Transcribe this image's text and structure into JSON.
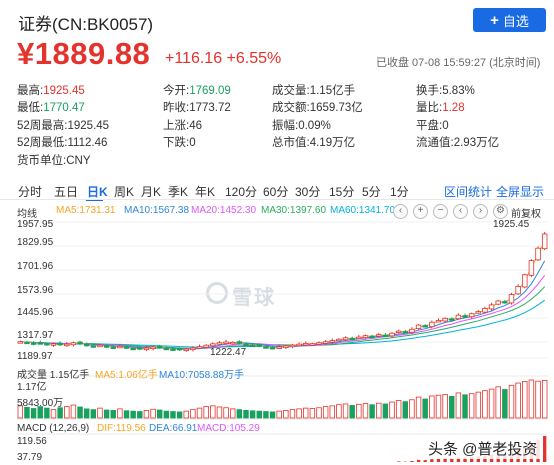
{
  "header": {
    "title": "证券(CN:BK0057)",
    "follow_label": "自选",
    "price": "¥1889.88",
    "change": "+116.16 +6.55%",
    "status": "已收盘 07-08 15:59:27 (北京时间)"
  },
  "stats": {
    "high_label": "最高:",
    "high": "1925.45",
    "low_label": "最低:",
    "low": "1770.47",
    "w52_high_label": "52周最高:",
    "w52_high": "1925.45",
    "w52_low_label": "52周最低:",
    "w52_low": "1112.46",
    "currency_label": "货币单位:",
    "currency": "CNY",
    "open_label": "今开:",
    "open": "1769.09",
    "prev_close_label": "昨收:",
    "prev_close": "1773.72",
    "up_label": "上涨:",
    "up": "46",
    "down_label": "下跌:",
    "down": "0",
    "volume_label": "成交量:",
    "volume": "1.15亿手",
    "amount_label": "成交额:",
    "amount": "1659.73亿",
    "amplitude_label": "振幅:",
    "amplitude": "0.09%",
    "mktcap_label": "总市值:",
    "mktcap": "4.19万亿",
    "turnover_label": "换手:",
    "turnover": "5.83%",
    "volratio_label": "量比:",
    "volratio": "1.28",
    "flat_label": "平盘:",
    "flat": "0",
    "float_label": "流通值:",
    "float": "2.93万亿"
  },
  "tabs": [
    "分时",
    "五日",
    "日K",
    "周K",
    "月K",
    "季K",
    "年K",
    "120分",
    "60分",
    "30分",
    "15分",
    "5分",
    "1分"
  ],
  "active_tab": "日K",
  "links": {
    "stats": "区间统计",
    "fullscreen": "全屏显示"
  },
  "legend": {
    "ma_type": "均线",
    "ma5": "MA5:1731.31",
    "ma10": "MA10:1567.38",
    "ma20": "MA20:1452.30",
    "ma30": "MA30:1397.60",
    "ma60": "MA60:1341.70",
    "fq": "前复权"
  },
  "colors": {
    "up": "#e4322c",
    "down": "#19a15f",
    "ma5": "#f5a623",
    "ma10": "#2e86de",
    "ma20": "#e056fd",
    "ma30": "#27ae60",
    "ma60": "#00b4d8"
  },
  "y_axis": [
    "1957.95",
    "1829.95",
    "1701.96",
    "1573.96",
    "1445.96",
    "1317.97",
    "1189.97"
  ],
  "price_labels": {
    "high": "1925.45",
    "low": "1222.47"
  },
  "volume": {
    "label": "成交量 1.15亿手",
    "ma5": "MA5:1.06亿手",
    "ma10": "MA10:7058.88万手",
    "axis_top": "1.17亿",
    "axis_mid": "5843.00万"
  },
  "macd": {
    "label": "MACD (12,26,9)",
    "dif": "DIF:119.56",
    "dea": "DEA:66.91",
    "macd": "MACD:105.29",
    "axis_top": "119.56",
    "axis_mid": "37.79"
  },
  "watermark": "雪球",
  "credit": "头条 @普老投资",
  "chart_data": {
    "type": "candlestick",
    "ylim": [
      1189.97,
      1957.95
    ],
    "closes": [
      1282,
      1278,
      1272,
      1275,
      1266,
      1270,
      1264,
      1268,
      1276,
      1270,
      1262,
      1258,
      1262,
      1255,
      1250,
      1256,
      1248,
      1244,
      1240,
      1246,
      1252,
      1248,
      1244,
      1240,
      1236,
      1240,
      1246,
      1254,
      1262,
      1270,
      1276,
      1280,
      1278,
      1272,
      1266,
      1262,
      1256,
      1252,
      1248,
      1252,
      1258,
      1262,
      1268,
      1272,
      1270,
      1276,
      1282,
      1288,
      1296,
      1304,
      1300,
      1308,
      1316,
      1312,
      1322,
      1318,
      1330,
      1342,
      1338,
      1352,
      1376,
      1370,
      1392,
      1402,
      1414,
      1408,
      1432,
      1426,
      1440,
      1452,
      1470,
      1490,
      1512,
      1504,
      1548,
      1594,
      1660,
      1740,
      1810,
      1890
    ],
    "volumes_rel": [
      0.32,
      0.28,
      0.25,
      0.3,
      0.26,
      0.22,
      0.27,
      0.3,
      0.34,
      0.29,
      0.24,
      0.22,
      0.26,
      0.21,
      0.2,
      0.24,
      0.19,
      0.18,
      0.17,
      0.2,
      0.23,
      0.21,
      0.18,
      0.17,
      0.16,
      0.18,
      0.22,
      0.26,
      0.3,
      0.32,
      0.29,
      0.27,
      0.24,
      0.22,
      0.2,
      0.19,
      0.18,
      0.17,
      0.16,
      0.18,
      0.2,
      0.22,
      0.24,
      0.26,
      0.25,
      0.27,
      0.3,
      0.32,
      0.35,
      0.37,
      0.33,
      0.36,
      0.38,
      0.35,
      0.39,
      0.37,
      0.42,
      0.46,
      0.43,
      0.48,
      0.55,
      0.5,
      0.58,
      0.6,
      0.62,
      0.57,
      0.66,
      0.61,
      0.64,
      0.68,
      0.72,
      0.76,
      0.82,
      0.75,
      0.86,
      0.92,
      0.96,
      1.0,
      0.97,
      0.99
    ]
  }
}
